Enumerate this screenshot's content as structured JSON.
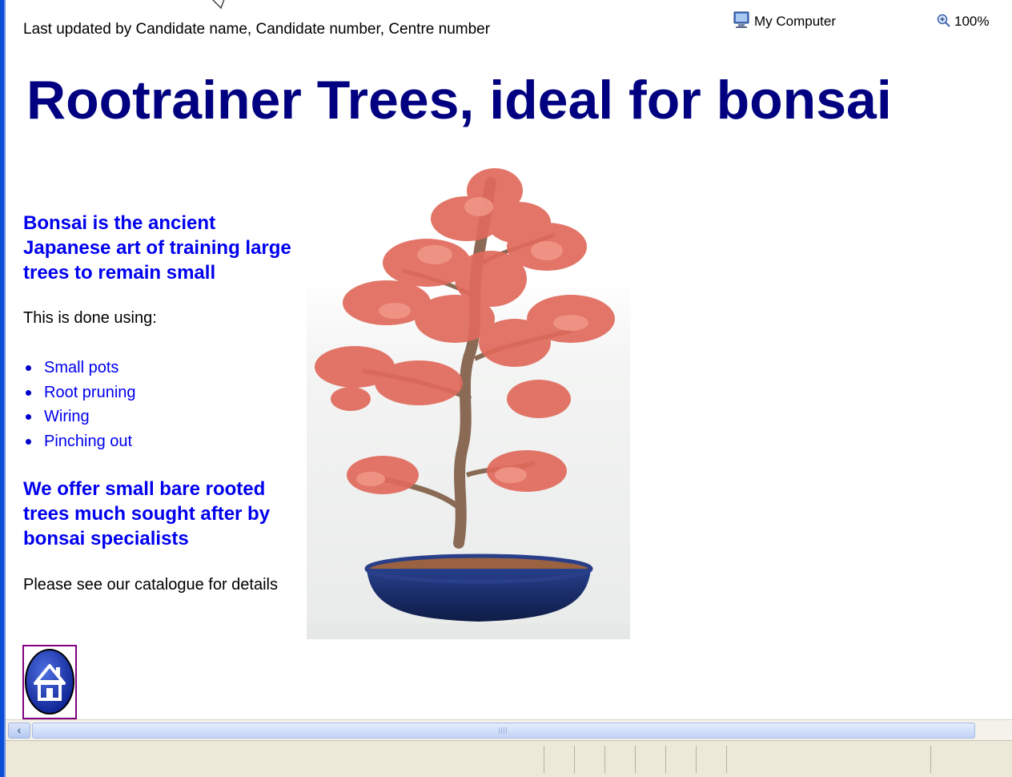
{
  "page": {
    "updated_line": "Last updated by Candidate name, Candidate number, Centre number",
    "title": "Rootrainer Trees, ideal for bonsai",
    "intro_heading": "Bonsai is the ancient Japanese art of training large trees to remain small",
    "done_using": "This is done using:",
    "methods": [
      "Small pots",
      "Root pruning",
      "Wiring",
      "Pinching out"
    ],
    "offer_heading": "We offer small bare rooted trees much sought after by bonsai specialists",
    "catalogue_text": "Please see our catalogue for details",
    "home_icon": "home-icon"
  },
  "status_bar": {
    "zone": "My Computer",
    "zoom": "100%",
    "zone_icon": "computer-icon",
    "zoom_icon": "magnifier-icon"
  },
  "colors": {
    "title": "#000080",
    "heading": "#0000ee",
    "link": "#0000ee",
    "visited_border": "#800080"
  }
}
